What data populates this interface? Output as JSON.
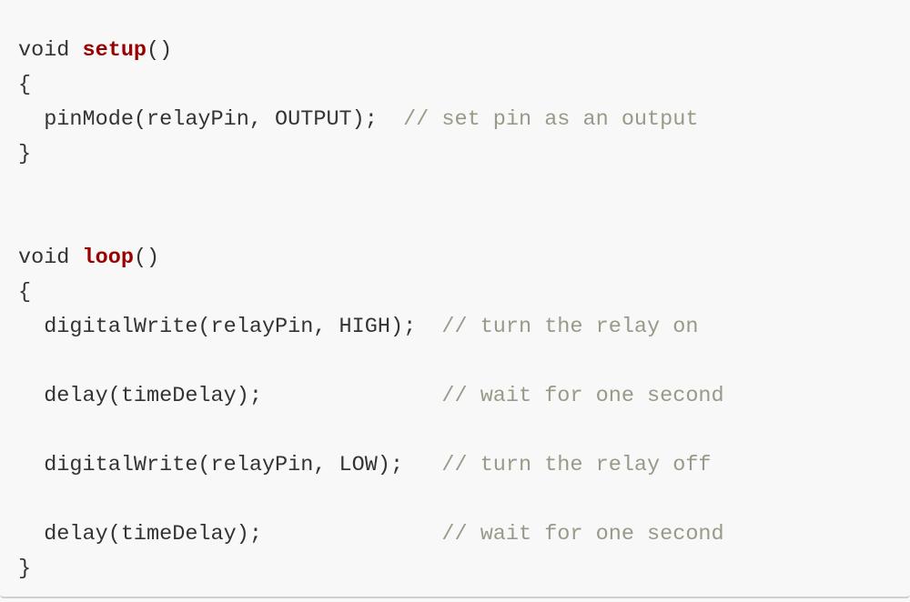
{
  "code": {
    "lines": [
      {
        "parts": [
          {
            "t": "void ",
            "c": "kw"
          },
          {
            "t": "setup",
            "c": "fn"
          },
          {
            "t": "()",
            "c": "kw"
          }
        ]
      },
      {
        "parts": [
          {
            "t": "{",
            "c": "kw"
          }
        ]
      },
      {
        "parts": [
          {
            "t": "  pinMode(relayPin, OUTPUT);  ",
            "c": "kw"
          },
          {
            "t": "// set pin as an output",
            "c": "cm"
          }
        ]
      },
      {
        "parts": [
          {
            "t": "}",
            "c": "kw"
          }
        ]
      },
      {
        "parts": []
      },
      {
        "parts": []
      },
      {
        "parts": [
          {
            "t": "void ",
            "c": "kw"
          },
          {
            "t": "loop",
            "c": "fn"
          },
          {
            "t": "()",
            "c": "kw"
          }
        ]
      },
      {
        "parts": [
          {
            "t": "{",
            "c": "kw"
          }
        ]
      },
      {
        "parts": [
          {
            "t": "  digitalWrite(relayPin, HIGH);  ",
            "c": "kw"
          },
          {
            "t": "// turn the relay on",
            "c": "cm"
          }
        ]
      },
      {
        "parts": []
      },
      {
        "parts": [
          {
            "t": "  delay(timeDelay);              ",
            "c": "kw"
          },
          {
            "t": "// wait for one second",
            "c": "cm"
          }
        ]
      },
      {
        "parts": []
      },
      {
        "parts": [
          {
            "t": "  digitalWrite(relayPin, LOW);   ",
            "c": "kw"
          },
          {
            "t": "// turn the relay off",
            "c": "cm"
          }
        ]
      },
      {
        "parts": []
      },
      {
        "parts": [
          {
            "t": "  delay(timeDelay);              ",
            "c": "kw"
          },
          {
            "t": "// wait for one second",
            "c": "cm"
          }
        ]
      },
      {
        "parts": [
          {
            "t": "}",
            "c": "kw"
          }
        ]
      }
    ]
  },
  "colors": {
    "keyword_function": "#990000",
    "comment": "#999988",
    "text": "#333333",
    "background": "#f8f8f8"
  }
}
